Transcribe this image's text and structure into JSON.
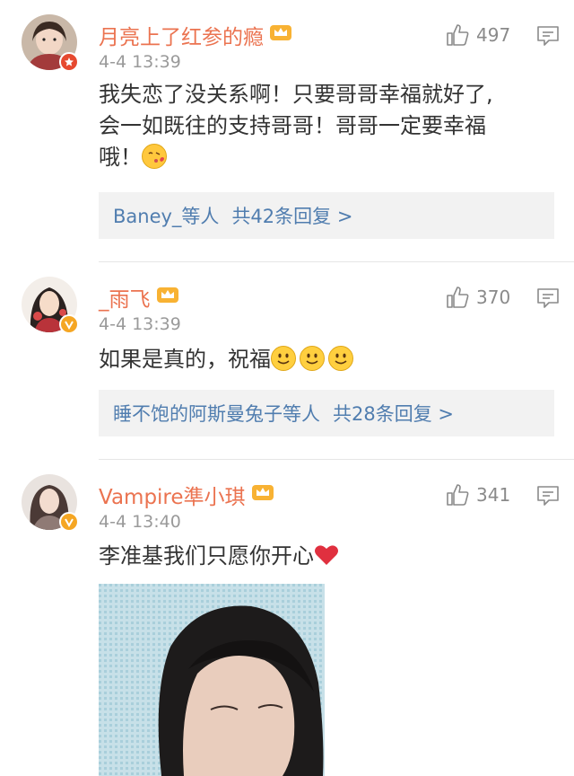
{
  "comments": [
    {
      "username": "月亮上了红参的瘾",
      "time": "4-4 13:39",
      "likes": "497",
      "text_lines": [
        "我失恋了没关系啊！只要哥哥幸福就好了,",
        "会一如既往的支持哥哥！哥哥一定要幸福",
        "哦！"
      ],
      "reply_users": "Baney_等人",
      "reply_count": "共42条回复 >"
    },
    {
      "username": "_雨飞",
      "time": "4-4 13:39",
      "likes": "370",
      "text": "如果是真的，祝福",
      "reply_users": "睡不饱的阿斯曼兔子等人",
      "reply_count": "共28条回复 >"
    },
    {
      "username": "Vampire準小琪",
      "time": "4-4 13:40",
      "likes": "341",
      "text": "李准基我们只愿你开心"
    }
  ],
  "colors": {
    "username": "#eb7350",
    "link": "#507daf",
    "time": "#9a9a9a",
    "reply_bg": "#f2f2f2"
  }
}
